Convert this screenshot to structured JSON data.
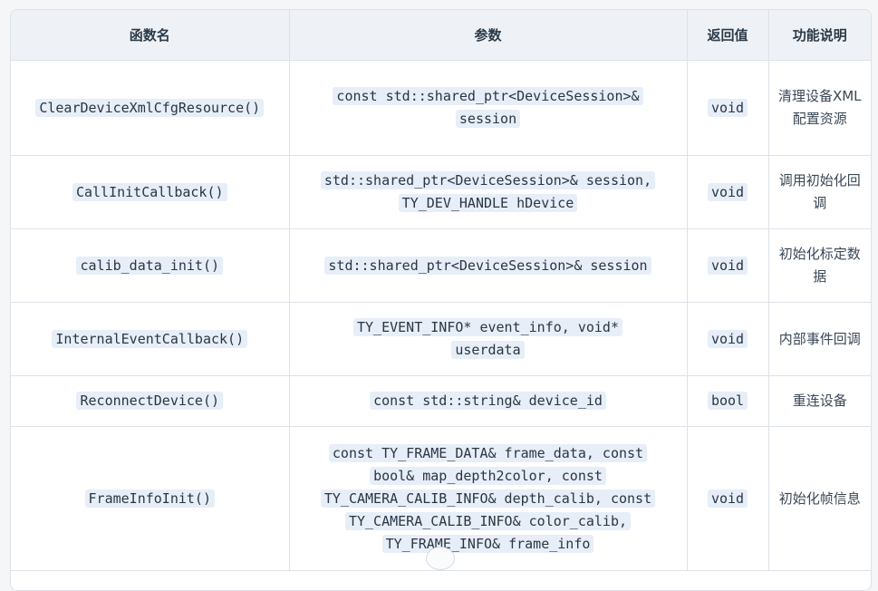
{
  "table": {
    "headers": [
      "函数名",
      "参数",
      "返回值",
      "功能说明"
    ],
    "rows": [
      {
        "name": "ClearDeviceXmlCfgResource()",
        "params": "const std::shared_ptr<DeviceSession>& session",
        "ret": "void",
        "desc": "清理设备XML配置资源"
      },
      {
        "name": "CallInitCallback()",
        "params": "std::shared_ptr<DeviceSession>& session, TY_DEV_HANDLE hDevice",
        "ret": "void",
        "desc": "调用初始化回调"
      },
      {
        "name": "calib_data_init()",
        "params": "std::shared_ptr<DeviceSession>& session",
        "ret": "void",
        "desc": "初始化标定数据"
      },
      {
        "name": "InternalEventCallback()",
        "params": "TY_EVENT_INFO* event_info, void* userdata",
        "ret": "void",
        "desc": "内部事件回调"
      },
      {
        "name": "ReconnectDevice()",
        "params": "const std::string& device_id",
        "ret": "bool",
        "desc": "重连设备"
      },
      {
        "name": "FrameInfoInit()",
        "params": "const TY_FRAME_DATA& frame_data, const bool& map_depth2color, const TY_CAMERA_CALIB_INFO& depth_calib, const TY_CAMERA_CALIB_INFO& color_calib, TY_FRAME_INFO& frame_info",
        "ret": "void",
        "desc": "初始化帧信息"
      }
    ]
  }
}
